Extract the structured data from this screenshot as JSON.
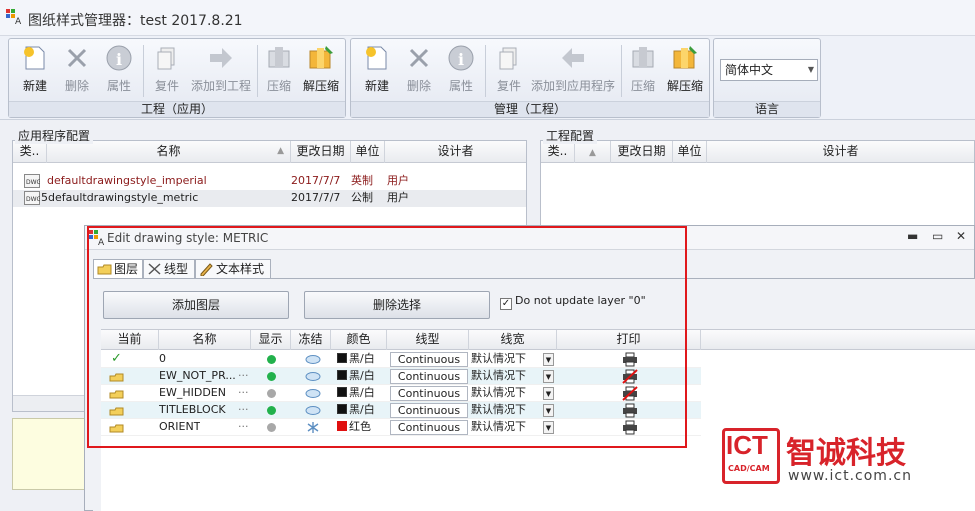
{
  "window": {
    "title": "图纸样式管理器：test 2017.8.21"
  },
  "ribbon": {
    "groups": [
      {
        "caption": "工程（应用）",
        "buttons": [
          {
            "label": "新建",
            "icon": "new-icon"
          },
          {
            "label": "删除",
            "icon": "delete-icon"
          },
          {
            "label": "属性",
            "icon": "info-icon"
          },
          {
            "label": "复件",
            "icon": "copy-icon"
          },
          {
            "label": "添加到工程",
            "icon": "arrow-right-icon"
          },
          {
            "label": "压缩",
            "icon": "compress-icon"
          },
          {
            "label": "解压缩",
            "icon": "extract-icon"
          }
        ]
      },
      {
        "caption": "管理（工程）",
        "buttons": [
          {
            "label": "新建",
            "icon": "new-icon"
          },
          {
            "label": "删除",
            "icon": "delete-icon"
          },
          {
            "label": "属性",
            "icon": "info-icon"
          },
          {
            "label": "复件",
            "icon": "copy-icon"
          },
          {
            "label": "添加到应用程序",
            "icon": "arrow-left-icon"
          },
          {
            "label": "压缩",
            "icon": "compress-icon"
          },
          {
            "label": "解压缩",
            "icon": "extract-icon"
          }
        ]
      },
      {
        "caption": "语言",
        "select_value": "简体中文"
      }
    ]
  },
  "app_config": {
    "title": "应用程序配置",
    "columns": [
      "类..",
      "名称",
      "更改日期",
      "单位",
      "设计者"
    ],
    "rows": [
      {
        "type": "",
        "name": "defaultdrawingstyle_imperial",
        "date": "2017/7/7",
        "unit": "英制",
        "designer": "用户"
      },
      {
        "type": "5",
        "name": "defaultdrawingstyle_metric",
        "date": "2017/7/7",
        "unit": "公制",
        "designer": "用户"
      }
    ]
  },
  "project_config": {
    "title": "工程配置",
    "columns": [
      "类..",
      "",
      "更改日期",
      "单位",
      "设计者"
    ]
  },
  "dialog": {
    "title": "Edit drawing style: METRIC",
    "tabs": [
      "图层",
      "线型",
      "文本样式"
    ],
    "add_layer_label": "添加图层",
    "delete_selected_label": "删除选择",
    "checkbox_label": "Do not update layer \"0\"",
    "columns": [
      "当前",
      "名称",
      "显示",
      "冻结",
      "颜色",
      "线型",
      "线宽",
      "打印"
    ],
    "layers": [
      {
        "name": "0",
        "current": true,
        "visible": "on",
        "color_hex": "#111111",
        "color": "黑/白",
        "linetype": "Continuous",
        "lineweight": "默认情况下",
        "plot": "printer"
      },
      {
        "name": "EW_NOT_PR...",
        "current": false,
        "visible": "on",
        "color_hex": "#111111",
        "color": "黑/白",
        "linetype": "Continuous",
        "lineweight": "默认情况下",
        "plot": "no-print"
      },
      {
        "name": "EW_HIDDEN",
        "current": false,
        "visible": "off",
        "color_hex": "#111111",
        "color": "黑/白",
        "linetype": "Continuous",
        "lineweight": "默认情况下",
        "plot": "no-print"
      },
      {
        "name": "TITLEBLOCK",
        "current": false,
        "visible": "on",
        "color_hex": "#111111",
        "color": "黑/白",
        "linetype": "Continuous",
        "lineweight": "默认情况下",
        "plot": "printer"
      },
      {
        "name": "ORIENT",
        "current": false,
        "visible": "off",
        "color_hex": "#e01010",
        "color": "红色",
        "linetype": "Continuous",
        "lineweight": "默认情况下",
        "plot": "printer"
      }
    ]
  },
  "watermark": {
    "brand": "ICT",
    "sub": "CAD/CAM",
    "cn_name": "智诚科技",
    "url": "www.ict.com.cn"
  },
  "colors": {
    "accent_red": "#e0181c",
    "visible_on": "#22b14c",
    "visible_off": "#a8a8a8"
  }
}
